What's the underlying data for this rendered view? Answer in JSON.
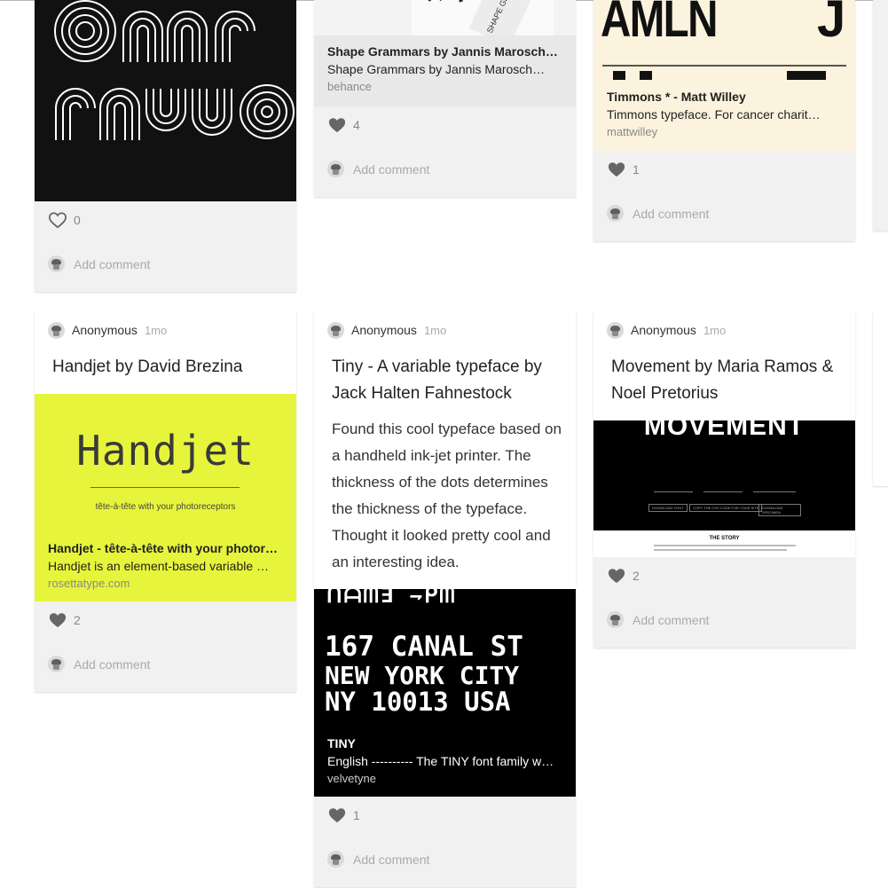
{
  "cards": {
    "omar": {
      "likes": "0",
      "comment": "Add comment"
    },
    "shape": {
      "link_title": "Shape Grammars by Jannis Marosch…",
      "link_desc": "Shape Grammars by Jannis Marosch…",
      "link_domain": "behance",
      "likes": "4",
      "comment": "Add comment"
    },
    "timmons": {
      "image_text": "AMLN",
      "link_title": "Timmons * - Matt Willey",
      "link_desc": "Timmons typeface. For cancer charit…",
      "link_domain": "mattwilley",
      "likes": "1",
      "comment": "Add comment"
    },
    "handjet": {
      "author": "Anonymous",
      "time": "1mo",
      "title": "Handjet by David Brezina",
      "image_title": "Handjet",
      "image_tagline": "tête-à-tête with your photoreceptors",
      "link_title": "Handjet - tête-à-tête with your photor…",
      "link_desc": "Handjet is an element-based variable …",
      "link_domain": "rosettatype.com",
      "likes": "2",
      "comment": "Add comment"
    },
    "tiny": {
      "author": "Anonymous",
      "time": "1mo",
      "title": "Tiny - A variable typeface by Jack Halten Fahnestock",
      "body": "Found this cool typeface based on a handheld ink-jet printer. The thickness of the dots determines the thickness of the typeface. Thought it looked pretty cool and an interesting idea.",
      "image_line1": "167 CANAL ST",
      "image_line2": "NEW YORK CITY",
      "image_line3": "NY 10013 USA",
      "link_title": "TINY",
      "link_desc": "English ---------- The TINY font family w…",
      "link_domain": "velvetyne",
      "likes": "1",
      "comment": "Add comment"
    },
    "movement": {
      "author": "Anonymous",
      "time": "1mo",
      "title": "Movement by Maria Ramos & Noel Pretorius",
      "image_heading": "MOVEMENT",
      "image_btn1": "DOWNLOAD FONT",
      "image_btn2": "COPY THE CSS CODE FOR YOUR SITE",
      "image_btn3": "DOWNLOAD SPECIMEN",
      "image_story": "THE STORY",
      "likes": "2",
      "comment": "Add comment"
    }
  },
  "colors": {
    "card_bg": "#f1f1f1",
    "handjet_bg": "#e6f53b",
    "timmons_bg": "#fbf3de",
    "shape_bg": "#e8e8e8",
    "like_heart": "#666666"
  }
}
